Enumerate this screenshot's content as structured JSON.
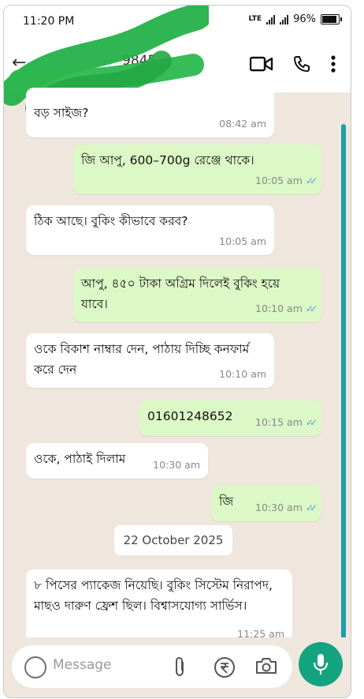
{
  "status": {
    "time": "11:20 PM",
    "network": "LTE",
    "battery": "96%"
  },
  "header": {
    "contact_number_visible": "9845"
  },
  "messages": [
    {
      "direction": "in",
      "text": "বড় সাইজ?",
      "time": "08:42 am"
    },
    {
      "direction": "out",
      "text": "জি আপু, 600–700g রেঞ্জে থাকে।",
      "time": "10:05 am"
    },
    {
      "direction": "in",
      "text": "ঠিক আছে। বুকিং কীভাবে করব?",
      "time": "10:05 am"
    },
    {
      "direction": "out",
      "text": "আপু, ৪৫০ টাকা অগ্রিম দিলেই বুকিং হয়ে যাবে।",
      "time": "10:10 am"
    },
    {
      "direction": "in",
      "text": "ওকে বিকাশ নাম্বার দেন, পাঠায় দিচ্ছি কনফার্ম করে দেন",
      "time": "10:10 am"
    },
    {
      "direction": "out",
      "text": "01601248652",
      "time": "10:15 am"
    },
    {
      "direction": "in",
      "text": "ওকে, পাঠাই দিলাম",
      "time": "10:30 am"
    },
    {
      "direction": "out",
      "text": "জি",
      "time": "10:30 am"
    },
    {
      "direction": "in",
      "text": "৮ পিসের প্যাকেজ নিয়েছি। বুকিং সিস্টেম নিরাপদ, মাছও দারুণ ফ্রেশ ছিল। বিশ্বাসযোগ্য সার্ভিস।",
      "time": "11:25 am"
    }
  ],
  "date_divider": "22 October 2025",
  "input": {
    "placeholder": "Message"
  },
  "colors": {
    "outgoing": "#dcf8c6",
    "incoming": "#ffffff",
    "accent": "#14a37f",
    "ticks": "#4fa3e0"
  }
}
